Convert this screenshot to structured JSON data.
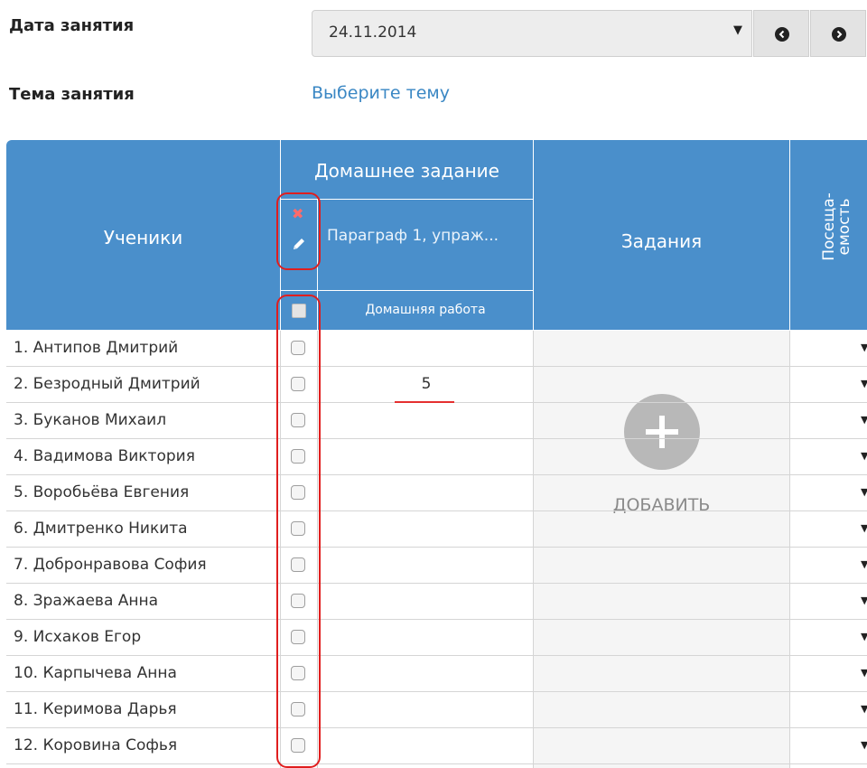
{
  "form": {
    "date_label": "Дата занятия",
    "date_value": "24.11.2014",
    "topic_label": "Тема занятия",
    "topic_link": "Выберите тему"
  },
  "table": {
    "students_header": "Ученики",
    "homework_header": "Домашнее задание",
    "homework_text": "Параграф 1, упраж...",
    "homework_sub": "Домашняя работа",
    "tasks_header": "Задания",
    "attendance_header": "Посеща-\nемость",
    "add_label": "ДОБАВИТЬ"
  },
  "students": [
    {
      "name": "1. Антипов Дмитрий",
      "grade": ""
    },
    {
      "name": "2. Безродный Дмитрий",
      "grade": "5"
    },
    {
      "name": "3. Буканов Михаил",
      "grade": ""
    },
    {
      "name": "4. Вадимова Виктория",
      "grade": ""
    },
    {
      "name": "5. Воробьёва Евгения",
      "grade": ""
    },
    {
      "name": "6. Дмитренко Никита",
      "grade": ""
    },
    {
      "name": "7. Добронравова София",
      "grade": ""
    },
    {
      "name": "8. Зражаева Анна",
      "grade": ""
    },
    {
      "name": "9. Исхаков Егор",
      "grade": ""
    },
    {
      "name": "10. Карпычева Анна",
      "grade": ""
    },
    {
      "name": "11. Керимова Дарья",
      "grade": ""
    },
    {
      "name": "12. Коровина Софья",
      "grade": ""
    }
  ],
  "colors": {
    "header_blue": "#4a8fcb",
    "link_blue": "#3a87c4",
    "highlight_red": "#e01e1e"
  }
}
